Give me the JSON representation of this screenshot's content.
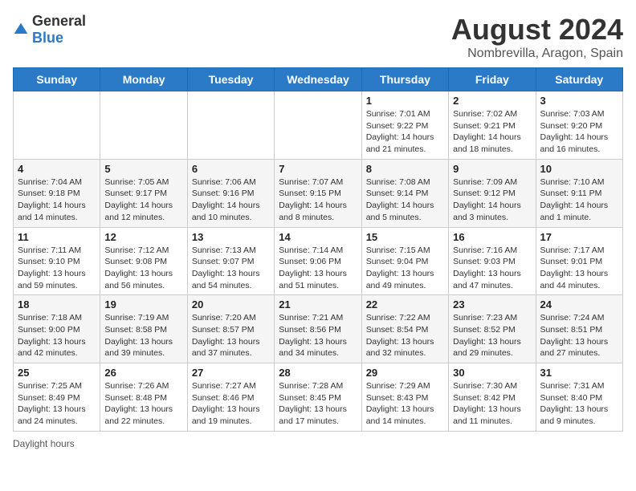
{
  "header": {
    "logo_general": "General",
    "logo_blue": "Blue",
    "title": "August 2024",
    "subtitle": "Nombrevilla, Aragon, Spain"
  },
  "columns": [
    "Sunday",
    "Monday",
    "Tuesday",
    "Wednesday",
    "Thursday",
    "Friday",
    "Saturday"
  ],
  "weeks": [
    [
      {
        "day": "",
        "info": ""
      },
      {
        "day": "",
        "info": ""
      },
      {
        "day": "",
        "info": ""
      },
      {
        "day": "",
        "info": ""
      },
      {
        "day": "1",
        "info": "Sunrise: 7:01 AM\nSunset: 9:22 PM\nDaylight: 14 hours and 21 minutes."
      },
      {
        "day": "2",
        "info": "Sunrise: 7:02 AM\nSunset: 9:21 PM\nDaylight: 14 hours and 18 minutes."
      },
      {
        "day": "3",
        "info": "Sunrise: 7:03 AM\nSunset: 9:20 PM\nDaylight: 14 hours and 16 minutes."
      }
    ],
    [
      {
        "day": "4",
        "info": "Sunrise: 7:04 AM\nSunset: 9:18 PM\nDaylight: 14 hours and 14 minutes."
      },
      {
        "day": "5",
        "info": "Sunrise: 7:05 AM\nSunset: 9:17 PM\nDaylight: 14 hours and 12 minutes."
      },
      {
        "day": "6",
        "info": "Sunrise: 7:06 AM\nSunset: 9:16 PM\nDaylight: 14 hours and 10 minutes."
      },
      {
        "day": "7",
        "info": "Sunrise: 7:07 AM\nSunset: 9:15 PM\nDaylight: 14 hours and 8 minutes."
      },
      {
        "day": "8",
        "info": "Sunrise: 7:08 AM\nSunset: 9:14 PM\nDaylight: 14 hours and 5 minutes."
      },
      {
        "day": "9",
        "info": "Sunrise: 7:09 AM\nSunset: 9:12 PM\nDaylight: 14 hours and 3 minutes."
      },
      {
        "day": "10",
        "info": "Sunrise: 7:10 AM\nSunset: 9:11 PM\nDaylight: 14 hours and 1 minute."
      }
    ],
    [
      {
        "day": "11",
        "info": "Sunrise: 7:11 AM\nSunset: 9:10 PM\nDaylight: 13 hours and 59 minutes."
      },
      {
        "day": "12",
        "info": "Sunrise: 7:12 AM\nSunset: 9:08 PM\nDaylight: 13 hours and 56 minutes."
      },
      {
        "day": "13",
        "info": "Sunrise: 7:13 AM\nSunset: 9:07 PM\nDaylight: 13 hours and 54 minutes."
      },
      {
        "day": "14",
        "info": "Sunrise: 7:14 AM\nSunset: 9:06 PM\nDaylight: 13 hours and 51 minutes."
      },
      {
        "day": "15",
        "info": "Sunrise: 7:15 AM\nSunset: 9:04 PM\nDaylight: 13 hours and 49 minutes."
      },
      {
        "day": "16",
        "info": "Sunrise: 7:16 AM\nSunset: 9:03 PM\nDaylight: 13 hours and 47 minutes."
      },
      {
        "day": "17",
        "info": "Sunrise: 7:17 AM\nSunset: 9:01 PM\nDaylight: 13 hours and 44 minutes."
      }
    ],
    [
      {
        "day": "18",
        "info": "Sunrise: 7:18 AM\nSunset: 9:00 PM\nDaylight: 13 hours and 42 minutes."
      },
      {
        "day": "19",
        "info": "Sunrise: 7:19 AM\nSunset: 8:58 PM\nDaylight: 13 hours and 39 minutes."
      },
      {
        "day": "20",
        "info": "Sunrise: 7:20 AM\nSunset: 8:57 PM\nDaylight: 13 hours and 37 minutes."
      },
      {
        "day": "21",
        "info": "Sunrise: 7:21 AM\nSunset: 8:56 PM\nDaylight: 13 hours and 34 minutes."
      },
      {
        "day": "22",
        "info": "Sunrise: 7:22 AM\nSunset: 8:54 PM\nDaylight: 13 hours and 32 minutes."
      },
      {
        "day": "23",
        "info": "Sunrise: 7:23 AM\nSunset: 8:52 PM\nDaylight: 13 hours and 29 minutes."
      },
      {
        "day": "24",
        "info": "Sunrise: 7:24 AM\nSunset: 8:51 PM\nDaylight: 13 hours and 27 minutes."
      }
    ],
    [
      {
        "day": "25",
        "info": "Sunrise: 7:25 AM\nSunset: 8:49 PM\nDaylight: 13 hours and 24 minutes."
      },
      {
        "day": "26",
        "info": "Sunrise: 7:26 AM\nSunset: 8:48 PM\nDaylight: 13 hours and 22 minutes."
      },
      {
        "day": "27",
        "info": "Sunrise: 7:27 AM\nSunset: 8:46 PM\nDaylight: 13 hours and 19 minutes."
      },
      {
        "day": "28",
        "info": "Sunrise: 7:28 AM\nSunset: 8:45 PM\nDaylight: 13 hours and 17 minutes."
      },
      {
        "day": "29",
        "info": "Sunrise: 7:29 AM\nSunset: 8:43 PM\nDaylight: 13 hours and 14 minutes."
      },
      {
        "day": "30",
        "info": "Sunrise: 7:30 AM\nSunset: 8:42 PM\nDaylight: 13 hours and 11 minutes."
      },
      {
        "day": "31",
        "info": "Sunrise: 7:31 AM\nSunset: 8:40 PM\nDaylight: 13 hours and 9 minutes."
      }
    ]
  ],
  "footer": {
    "daylight_label": "Daylight hours"
  }
}
